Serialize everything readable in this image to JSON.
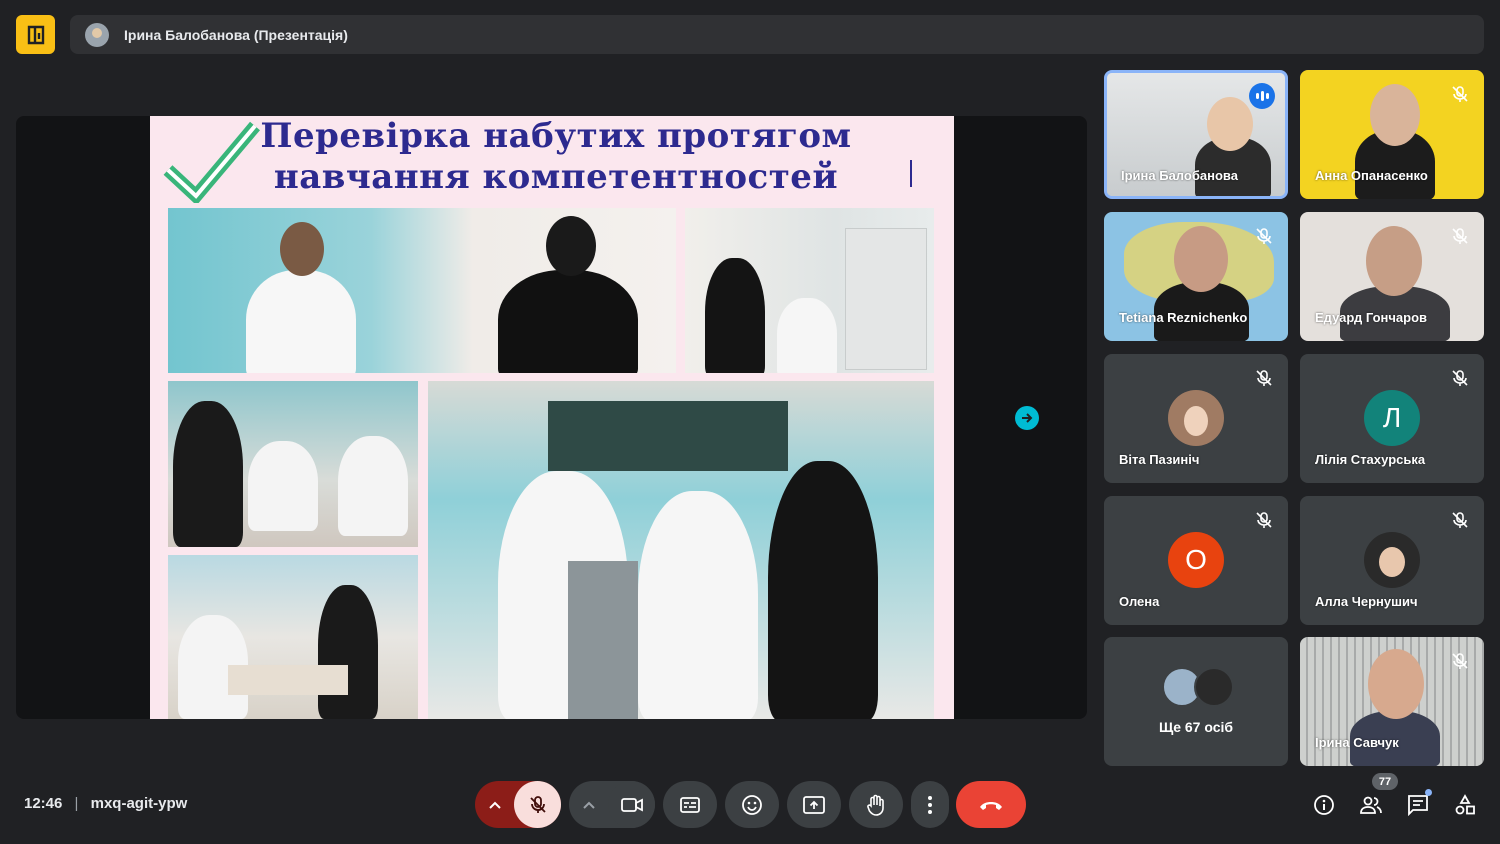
{
  "header": {
    "presenter_title": "Ірина Балобанова (Презентація)",
    "app_icon": "meet-window-icon"
  },
  "slide": {
    "title_line1": "Перевірка набутих протягом",
    "title_line2": "навчання компетентностей",
    "icon": "checkmark-icon"
  },
  "participants": [
    {
      "name": "Ірина Балобанова",
      "type": "video",
      "speaking": true
    },
    {
      "name": "Анна Опанасенко",
      "type": "video",
      "muted": true
    },
    {
      "name": "Tetiana Reznichenko",
      "type": "video",
      "muted": true
    },
    {
      "name": "Едуард Гончаров",
      "type": "video",
      "muted": true
    },
    {
      "name": "Віта Пазиніч",
      "type": "photo",
      "muted": true
    },
    {
      "name": "Лілія Стахурська",
      "type": "letter",
      "letter": "Л",
      "color": "#12837a",
      "muted": true
    },
    {
      "name": "Олена",
      "type": "letter",
      "letter": "О",
      "color": "#e8430f",
      "muted": true
    },
    {
      "name": "Алла Чернушич",
      "type": "photo",
      "muted": true
    },
    {
      "name": "Ще 67 осіб",
      "type": "more"
    },
    {
      "name": "Ірина Савчук",
      "type": "video",
      "muted": true
    }
  ],
  "footer": {
    "time": "12:46",
    "separator": "|",
    "meeting_code": "mxq-agit-ypw",
    "participant_count": "77",
    "colors": {
      "end_call": "#ea4335",
      "mic_off_bg": "#f9dedc",
      "accent": "#8ab4f8"
    }
  }
}
